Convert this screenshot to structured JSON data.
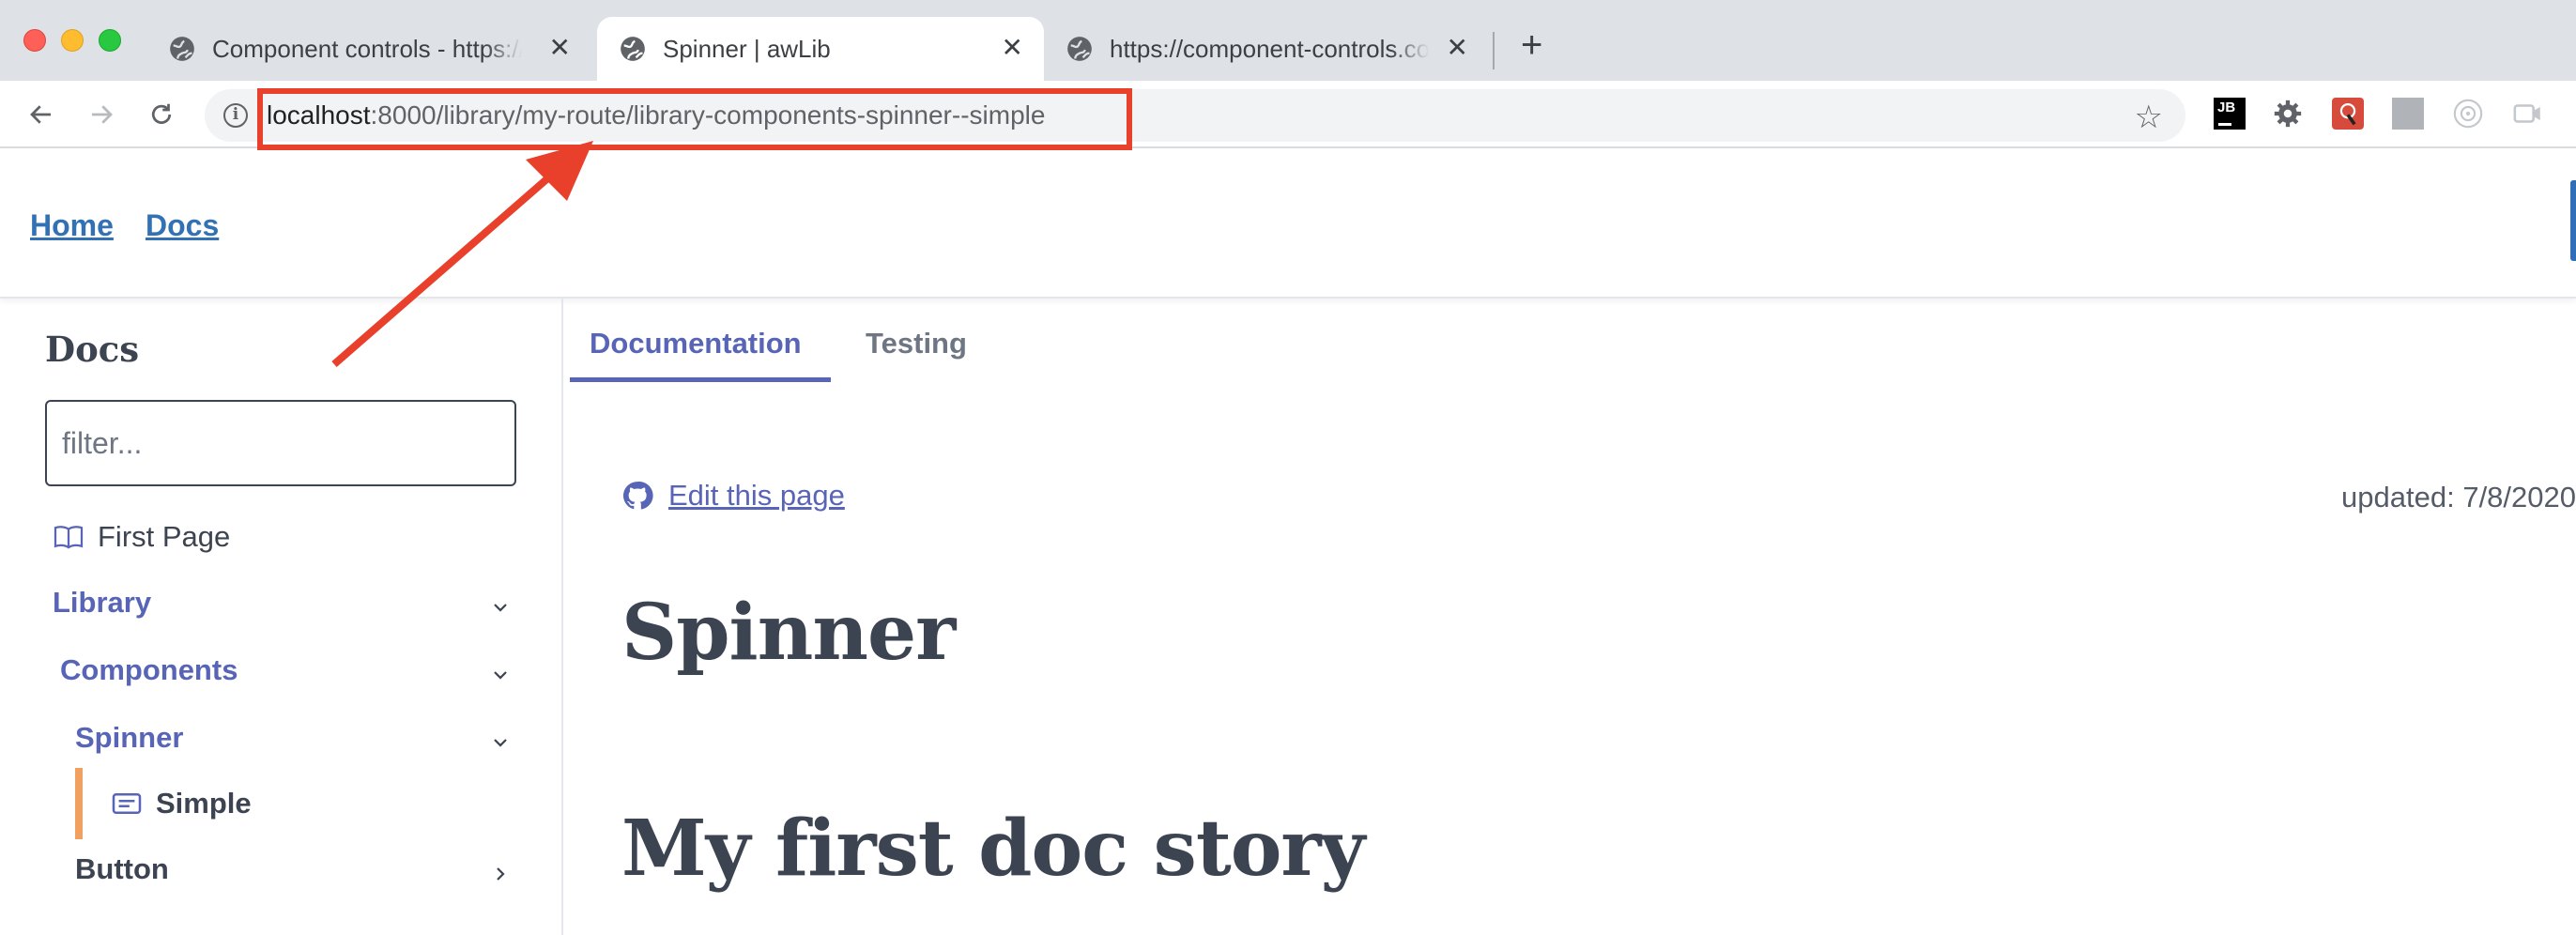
{
  "browser": {
    "tabs": [
      {
        "title": "Component controls - https://g",
        "active": false
      },
      {
        "title": "Spinner | awLib",
        "active": true
      },
      {
        "title": "https://component-controls.co",
        "active": false
      }
    ],
    "new_tab_label": "+",
    "close_label": "✕",
    "url": {
      "host": "localhost",
      "path": ":8000/library/my-route/library-components-spinner--simple"
    },
    "bookmark_icon": "star-icon",
    "extensions": [
      "jb-icon",
      "gear-extension-icon",
      "red-extension-icon",
      "grey-extension-icon",
      "target-extension-icon",
      "video-extension-icon"
    ],
    "annotation_color": "#e8402a"
  },
  "header": {
    "links": [
      "Home",
      "Docs"
    ]
  },
  "sidebar": {
    "title": "Docs",
    "filter_placeholder": "filter...",
    "items": [
      {
        "label": "First Page",
        "icon": "book-icon"
      },
      {
        "label": "Library",
        "expanded": true
      },
      {
        "label": "Components",
        "expanded": true
      },
      {
        "label": "Spinner",
        "expanded": true
      },
      {
        "label": "Simple",
        "icon": "story-icon",
        "active": true
      },
      {
        "label": "Button",
        "expanded": false
      }
    ],
    "accent": "#5865b6",
    "active_marker": "#f0a060"
  },
  "main": {
    "tabs": [
      "Documentation",
      "Testing"
    ],
    "active_tab": "Documentation",
    "edit_link": "Edit this page",
    "updated": "updated: 7/8/2020",
    "title": "Spinner",
    "story_title": "My first doc story"
  }
}
